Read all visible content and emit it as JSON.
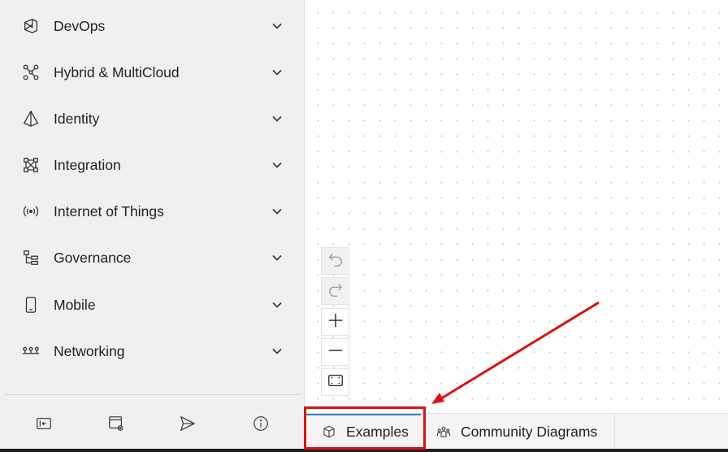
{
  "sidebar": {
    "categories": [
      {
        "label": "DevOps",
        "icon": "devops-icon"
      },
      {
        "label": "Hybrid & MultiCloud",
        "icon": "hybrid-multicloud-icon"
      },
      {
        "label": "Identity",
        "icon": "identity-icon"
      },
      {
        "label": "Integration",
        "icon": "integration-icon"
      },
      {
        "label": "Internet of Things",
        "icon": "iot-icon"
      },
      {
        "label": "Governance",
        "icon": "governance-icon"
      },
      {
        "label": "Mobile",
        "icon": "mobile-icon"
      },
      {
        "label": "Networking",
        "icon": "networking-icon"
      }
    ],
    "footer_icons": [
      "collapse-panel-icon",
      "settings-window-icon",
      "send-icon",
      "info-icon"
    ]
  },
  "canvas_toolbar": {
    "icons": [
      "undo-icon",
      "redo-icon",
      "zoom-in-icon",
      "zoom-out-icon",
      "fit-view-icon"
    ]
  },
  "bottom_tabs": [
    {
      "label": "Examples",
      "icon": "cube-icon",
      "active": true
    },
    {
      "label": "Community Diagrams",
      "icon": "people-icon",
      "active": false
    }
  ],
  "colors": {
    "sidebar_bg": "#f0f0f0",
    "accent_tab": "#3b7fc4",
    "annotation": "#e01010"
  }
}
